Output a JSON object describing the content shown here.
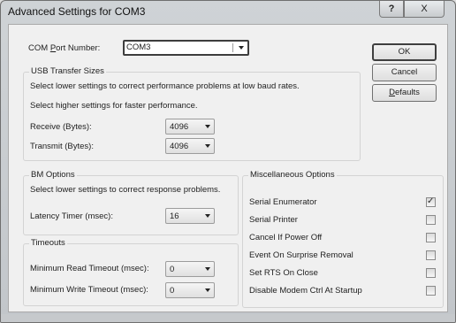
{
  "window": {
    "title": "Advanced Settings for COM3",
    "help_glyph": "?",
    "close_glyph": "X"
  },
  "com_port": {
    "label_pre": "COM ",
    "label_u": "P",
    "label_post": "ort Number:",
    "value": "COM3"
  },
  "buttons": {
    "ok": "OK",
    "cancel": "Cancel",
    "defaults_u": "D",
    "defaults_rest": "efaults"
  },
  "usb": {
    "title": "USB Transfer Sizes",
    "hint1": "Select lower settings to correct performance problems at low baud rates.",
    "hint2": "Select higher settings for faster performance.",
    "receive_label": "Receive (Bytes):",
    "receive_value": "4096",
    "transmit_label": "Transmit (Bytes):",
    "transmit_value": "4096"
  },
  "bm": {
    "title": "BM Options",
    "hint": "Select lower settings to correct response problems.",
    "latency_label": "Latency Timer (msec):",
    "latency_value": "16"
  },
  "timeouts": {
    "title": "Timeouts",
    "read_label": "Minimum Read Timeout (msec):",
    "read_value": "0",
    "write_label": "Minimum Write Timeout (msec):",
    "write_value": "0"
  },
  "misc": {
    "title": "Miscellaneous Options",
    "options": [
      {
        "label": "Serial Enumerator",
        "checked": true
      },
      {
        "label": "Serial Printer",
        "checked": false
      },
      {
        "label": "Cancel If Power Off",
        "checked": false
      },
      {
        "label": "Event On Surprise Removal",
        "checked": false
      },
      {
        "label": "Set RTS On Close",
        "checked": false
      },
      {
        "label": "Disable Modem Ctrl At Startup",
        "checked": false
      }
    ],
    "check_glyph": "✓"
  }
}
